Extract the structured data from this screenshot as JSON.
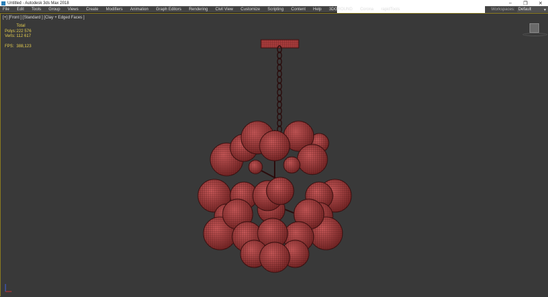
{
  "titlebar": {
    "title": "Untitled - Autodesk 3ds Max 2018",
    "minimize": "–",
    "restore": "❐",
    "close": "✕"
  },
  "menu": [
    "File",
    "Edit",
    "Tools",
    "Group",
    "Views",
    "Create",
    "Modifiers",
    "Animation",
    "Graph Editors",
    "Rendering",
    "Civil View",
    "Customize",
    "Scripting",
    "Content",
    "Help",
    "3DGROUND",
    "Corona",
    "rapidTools"
  ],
  "workspace": {
    "label": "Workspaces:",
    "value": "Default",
    "icon": "chevron-down-icon"
  },
  "viewport": {
    "label": "[+] [Front ] [Standard ] [Clay + Edged Faces ]",
    "stats": {
      "header": "Total",
      "polys_label": "Polys:",
      "polys": "222 576",
      "verts_label": "Verts:",
      "verts": "112 617",
      "fps_label": "FPS:",
      "fps": "388,123"
    }
  },
  "colors": {
    "model": "#a83c3c",
    "wire": "#3a1010",
    "stats": "#e8d050",
    "viewport_border": "#8a7a20"
  }
}
